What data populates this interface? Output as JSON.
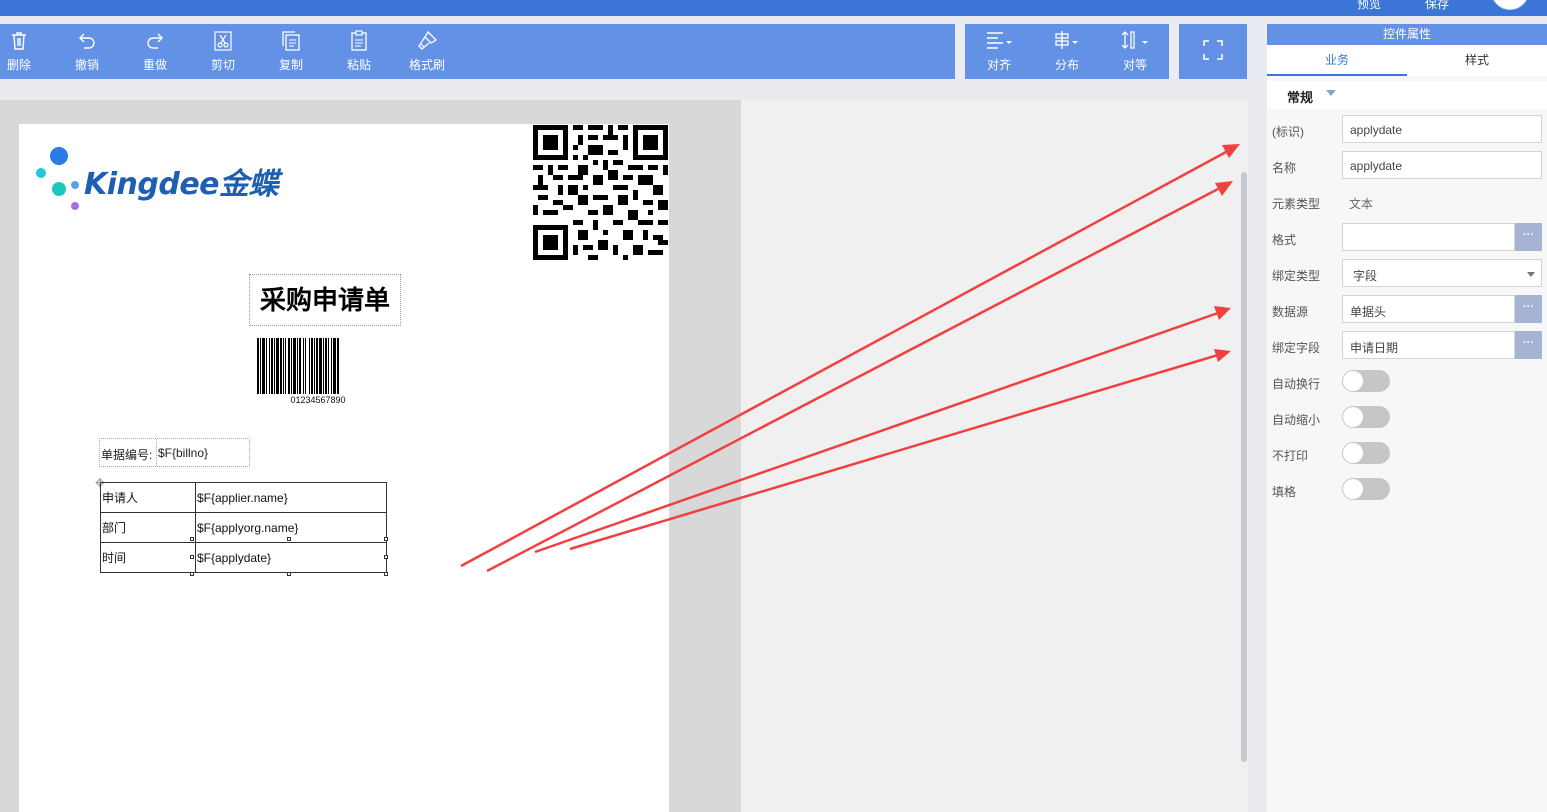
{
  "topbar": {
    "preview_label": "预览",
    "save_label": "保存"
  },
  "toolbar": {
    "delete_label": "删除",
    "undo_label": "撤销",
    "redo_label": "重做",
    "cut_label": "剪切",
    "copy_label": "复制",
    "paste_label": "粘贴",
    "format_painter_label": "格式刷",
    "align_label": "对齐",
    "distribute_label": "分布",
    "equalize_label": "对等"
  },
  "doc": {
    "logo_text": "Kingdee金蝶",
    "title": "采购申请单",
    "barcode_number": "01234567890",
    "billno_label": "单据编号:",
    "billno_value": "$F{billno}",
    "rows": [
      {
        "label": "申请人",
        "value": "$F{applier.name}"
      },
      {
        "label": "部门",
        "value": "$F{applyorg.name}"
      },
      {
        "label": "时间",
        "value": "$F{applydate}"
      }
    ]
  },
  "panel": {
    "title": "控件属性",
    "tab_business": "业务",
    "tab_style": "样式",
    "section_general": "常规",
    "id_label": "(标识)",
    "id_value": "applydate",
    "name_label": "名称",
    "name_value": "applydate",
    "element_type_label": "元素类型",
    "element_type_value": "文本",
    "format_label": "格式",
    "format_value": "",
    "dots": "···",
    "bind_type_label": "绑定类型",
    "bind_type_value": "字段",
    "datasource_label": "数据源",
    "datasource_value": "单据头",
    "bind_field_label": "绑定字段",
    "bind_field_value": "申请日期",
    "auto_wrap_label": "自动换行",
    "auto_shrink_label": "自动缩小",
    "no_print_label": "不打印",
    "fill_grid_label": "填格"
  },
  "colors": {
    "accent": "#3b76d6",
    "toolbar": "#6291e6",
    "arrow": "#f04040",
    "logo_blue": "#1f5fb3"
  }
}
